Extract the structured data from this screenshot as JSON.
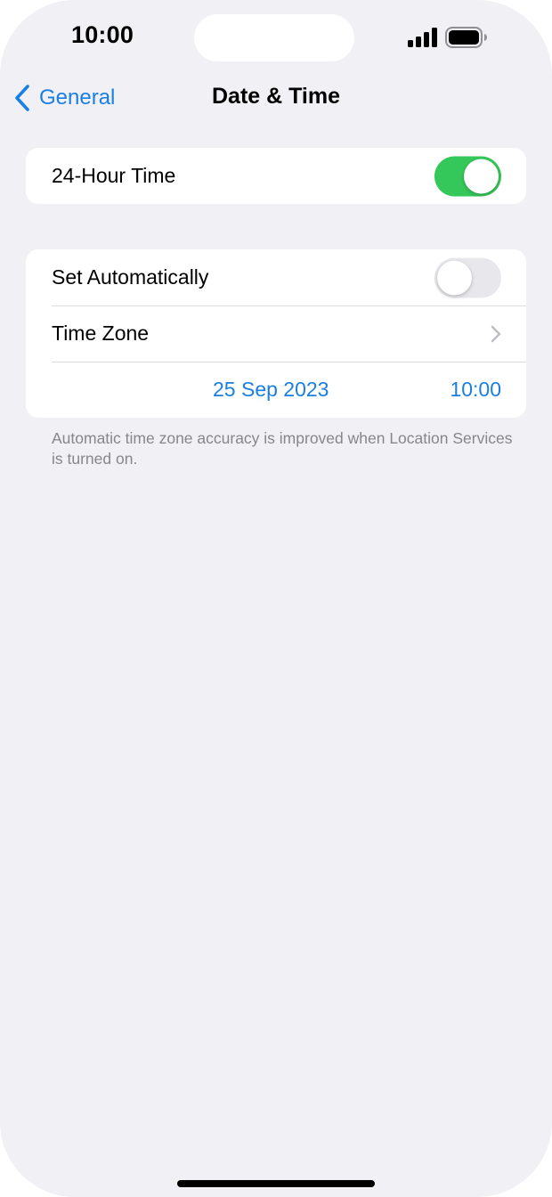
{
  "status_bar": {
    "time": "10:00",
    "icons": [
      "cellular-signal-icon",
      "battery-icon"
    ]
  },
  "nav": {
    "back_label": "General",
    "title": "Date & Time"
  },
  "group_time_format": {
    "label": "24-Hour Time",
    "enabled": true
  },
  "group_auto": {
    "set_automatically_label": "Set Automatically",
    "set_automatically_enabled": false,
    "time_zone_label": "Time Zone",
    "date_value": "25 Sep 2023",
    "time_value": "10:00"
  },
  "footnote": "Automatic time zone accuracy is improved when Location Services is turned on.",
  "colors": {
    "accent": "#1A7FE0",
    "toggle_on": "#34C759",
    "toggle_off": "#E8E8EC",
    "background": "#F0F0F5"
  }
}
